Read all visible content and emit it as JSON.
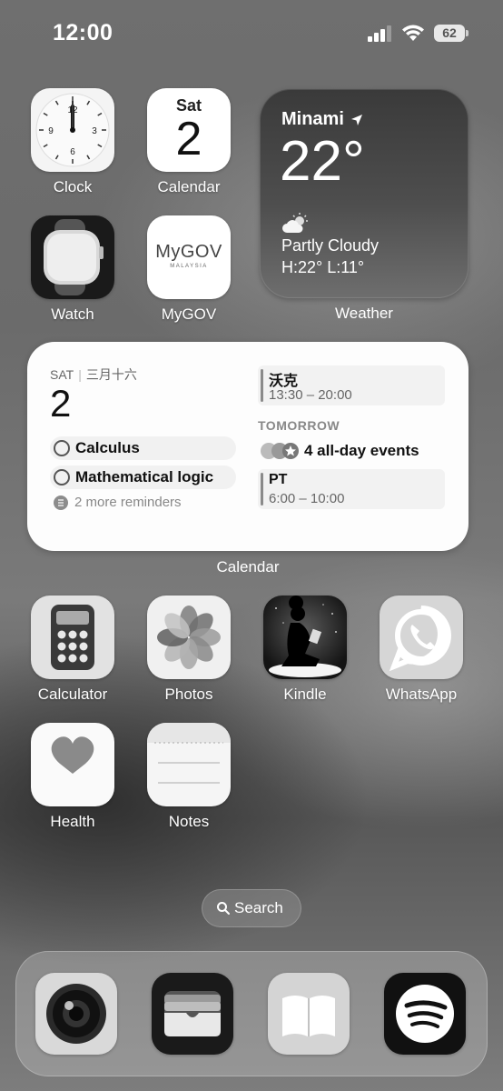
{
  "status_bar": {
    "time": "12:00",
    "battery": "62"
  },
  "apps_row1": [
    {
      "label": "Clock"
    },
    {
      "label": "Calendar",
      "day": "Sat",
      "date": "2"
    }
  ],
  "apps_row2": [
    {
      "label": "Watch"
    },
    {
      "label": "MyGOV",
      "logo_text": "MyGOV",
      "logo_sub": "MALAYSIA"
    }
  ],
  "weather": {
    "city": "Minami",
    "temperature": "22°",
    "condition": "Partly Cloudy",
    "high_low": "H:22° L:11°",
    "label": "Weather"
  },
  "calendar_widget": {
    "day": "SAT",
    "lunar": "三月十六",
    "date": "2",
    "reminders": [
      "Calculus",
      "Mathematical logic"
    ],
    "more_reminders": "2 more reminders",
    "today_event": {
      "title": "沃克",
      "time": "13:30 – 20:00"
    },
    "tomorrow_label": "TOMORROW",
    "all_day": "4 all-day events",
    "tomorrow_event": {
      "title": "PT",
      "time": "6:00 – 10:00"
    },
    "label": "Calendar"
  },
  "apps_row3": [
    {
      "label": "Calculator"
    },
    {
      "label": "Photos"
    },
    {
      "label": "Kindle"
    },
    {
      "label": "WhatsApp"
    }
  ],
  "apps_row4": [
    {
      "label": "Health"
    },
    {
      "label": "Notes"
    }
  ],
  "search": {
    "label": "Search"
  },
  "dock": [
    "camera-icon",
    "wallet-icon",
    "books-icon",
    "spotify-icon"
  ]
}
